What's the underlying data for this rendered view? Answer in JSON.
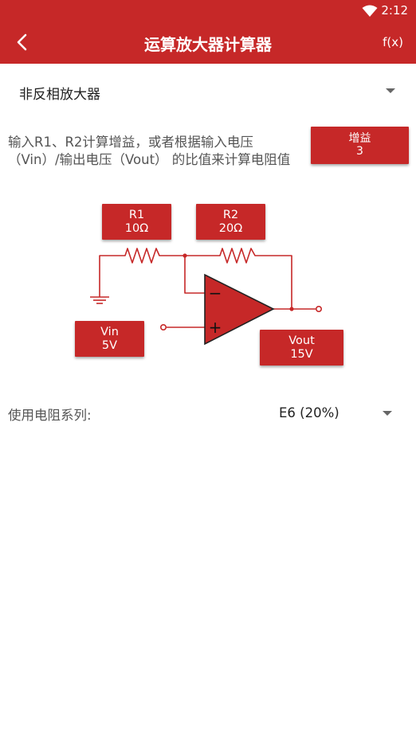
{
  "status_bar": {
    "time": "2:12",
    "wifi_icon": "wifi-icon"
  },
  "toolbar": {
    "title": "运算放大器计算器",
    "back_icon": "arrow-back-icon",
    "fx_label": "f(x)",
    "background_color": "#c62828"
  },
  "mode": {
    "selected": "非反相放大器"
  },
  "description": "输入R1、R2计算增益，或者根据输入电压（Vin）/输出电压（Vout） 的比值来计算电阻值",
  "gain": {
    "label": "增益",
    "value": "3"
  },
  "circuit": {
    "r1": {
      "label": "R1",
      "value": "10Ω"
    },
    "r2": {
      "label": "R2",
      "value": "20Ω"
    },
    "vin": {
      "label": "Vin",
      "value": "5V"
    },
    "vout": {
      "label": "Vout",
      "value": "15V"
    },
    "minus_sign": "−",
    "plus_sign": "+",
    "accent_color": "#c62828"
  },
  "series": {
    "label": "使用电阻系列:",
    "selected": "E6 (20%)"
  }
}
